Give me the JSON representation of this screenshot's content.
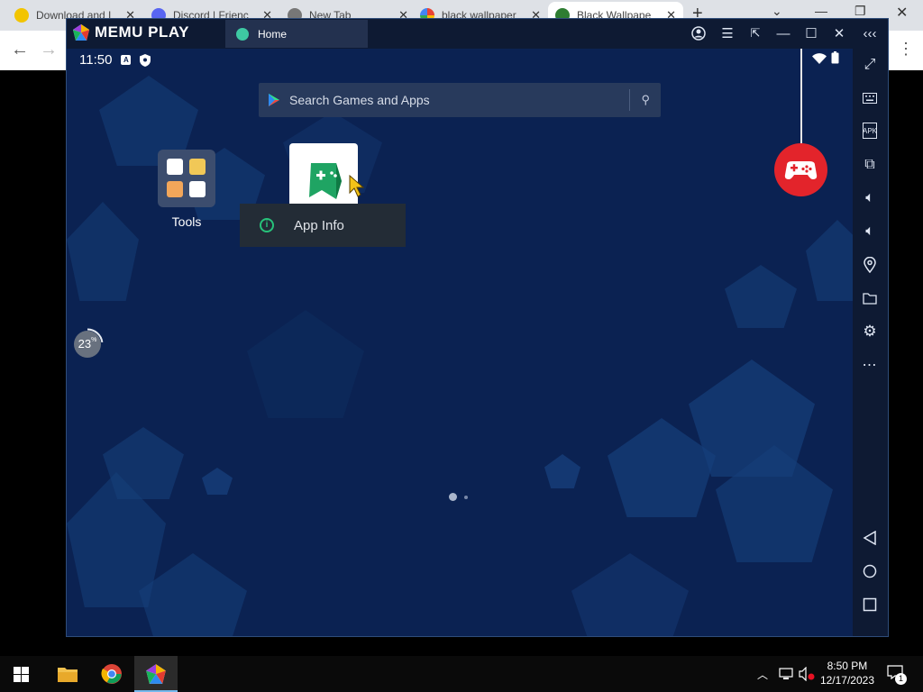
{
  "browser": {
    "tabs": [
      {
        "label": "Download and I",
        "icon": "pcloud-icon",
        "color": "#f2c400"
      },
      {
        "label": "Discord | Frienc",
        "icon": "discord-icon",
        "color": "#5865f2"
      },
      {
        "label": "New Tab",
        "icon": "chrome-icon",
        "color": "#555555"
      },
      {
        "label": "black wallpaper",
        "icon": "google-icon",
        "color": "#4285f4"
      },
      {
        "label": "Black Wallpape",
        "icon": "wallpaper-site-icon",
        "color": "#2e7d32"
      }
    ],
    "new_tab_glyph": "+"
  },
  "memu": {
    "brand": "MEMU PLAY",
    "home_tab": "Home",
    "status_time": "11:50",
    "search_placeholder": "Search Games and Apps",
    "tools_label": "Tools",
    "context_menu_item": "App Info",
    "progress_percent": "23",
    "progress_suffix": "%",
    "page_count": 2,
    "current_page": 1,
    "sidebar_icons": [
      "fullscreen-icon",
      "keyboard-icon",
      "apk-icon",
      "multi-instance-icon",
      "volume-up-icon",
      "volume-down-icon",
      "location-icon",
      "folder-icon",
      "settings-icon",
      "more-icon"
    ],
    "nav_icons": [
      "back-icon",
      "home-icon",
      "recents-icon"
    ]
  },
  "taskbar": {
    "time": "8:50 PM",
    "date": "12/17/2023",
    "notification_count": "1"
  },
  "colors": {
    "memu_bg": "#0b2252",
    "gamepad_red": "#e3242b",
    "context_green": "#27c27a"
  }
}
